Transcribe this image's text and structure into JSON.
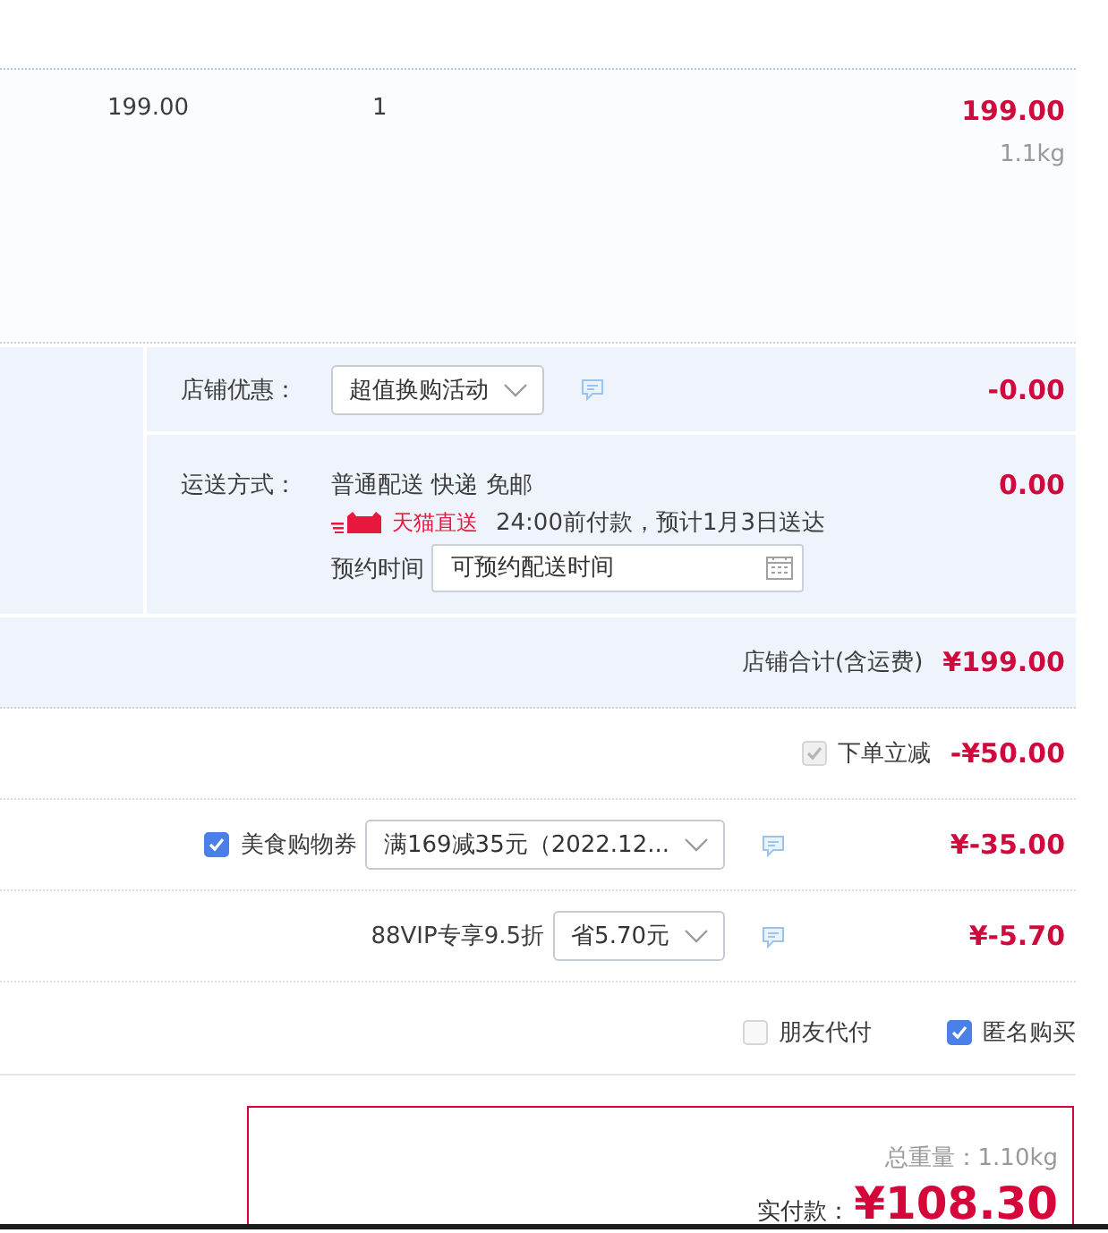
{
  "item": {
    "unit_price": "199.00",
    "quantity": "1",
    "subtotal": "199.00",
    "weight": "1.1kg"
  },
  "shop_discount": {
    "label": "店铺优惠：",
    "select": "超值换购活动",
    "amount": "-0.00"
  },
  "shipping": {
    "label": "运送方式：",
    "method": "普通配送 快递 免邮",
    "badge": "天猫直送",
    "eta": "24:00前付款，预计1月3日送达",
    "appointment": {
      "label": "预约时间",
      "placeholder": "可预约配送时间"
    },
    "amount": "0.00"
  },
  "shop_total": {
    "label": "店铺合计(含运费)",
    "amount": "¥199.00"
  },
  "discounts": [
    {
      "kind": "checkbox",
      "checked": true,
      "disabled": true,
      "label": "下单立减",
      "amount": "-¥50.00"
    },
    {
      "kind": "coupon",
      "checked": true,
      "disabled": false,
      "label": "美食购物券",
      "select": "满169减35元（2022.12...",
      "amount": "¥-35.00"
    },
    {
      "kind": "select",
      "label": "88VIP专享9.5折",
      "select": "省5.70元",
      "amount": "¥-5.70"
    }
  ],
  "options": [
    {
      "label": "朋友代付",
      "checked": false
    },
    {
      "label": "匿名购买",
      "checked": true
    }
  ],
  "summary": {
    "weight": "总重量：1.10kg",
    "paid_label": "实付款：",
    "paid_amount": "¥108.30"
  }
}
